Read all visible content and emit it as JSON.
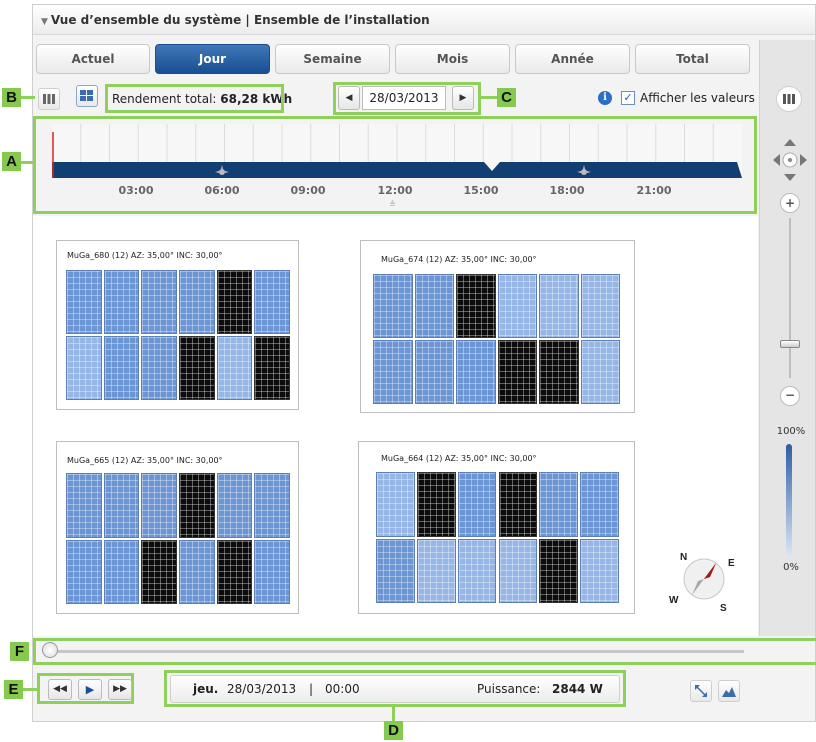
{
  "window": {
    "title": "Vue d’ensemble du système | Ensemble de l’installation"
  },
  "tabs": [
    {
      "label": "Actuel",
      "active": false
    },
    {
      "label": "Jour",
      "active": true
    },
    {
      "label": "Semaine",
      "active": false
    },
    {
      "label": "Mois",
      "active": false
    },
    {
      "label": "Année",
      "active": false
    },
    {
      "label": "Total",
      "active": false
    }
  ],
  "toolbar": {
    "yield_label": "Rendement total:",
    "yield_value": "68,28 kWh",
    "date": "28/03/2013",
    "show_values_label": "Afficher les valeurs",
    "show_values_checked": true
  },
  "timeline": {
    "ticks": [
      "03:00",
      "06:00",
      "09:00",
      "12:00",
      "15:00",
      "18:00",
      "21:00"
    ]
  },
  "panels": [
    {
      "title": "MuGa_680 (12) AZ: 35,00° INC: 30,00°",
      "cells": [
        1,
        1,
        1,
        1,
        0,
        1,
        2,
        1,
        1,
        0,
        2,
        0
      ]
    },
    {
      "title": "MuGa_674 (12) AZ: 35,00° INC: 30,00°",
      "cells": [
        1,
        1,
        0,
        2,
        2,
        2,
        1,
        1,
        1,
        0,
        0,
        2
      ]
    },
    {
      "title": "MuGa_665 (12) AZ: 35,00° INC: 30,00°",
      "cells": [
        1,
        1,
        1,
        0,
        1,
        1,
        1,
        1,
        0,
        1,
        0,
        1
      ]
    },
    {
      "title": "MuGa_664 (12) AZ: 35,00° INC: 30,00°",
      "cells": [
        2,
        0,
        1,
        0,
        1,
        1,
        1,
        2,
        2,
        2,
        0,
        2
      ]
    }
  ],
  "compass": {
    "n": "N",
    "e": "E",
    "s": "S",
    "w": "W"
  },
  "zoom": {
    "top_label": "100%",
    "bottom_label": "0%"
  },
  "status": {
    "day": "jeu.",
    "date": "28/03/2013",
    "separator": "|",
    "time": "00:00",
    "power_label": "Puissance:",
    "power_value": "2844 W"
  },
  "callouts": {
    "a": "A",
    "b": "B",
    "c": "C",
    "d": "D",
    "e": "E",
    "f": "F"
  },
  "colors": {
    "accent": "#174f92",
    "callout": "#86c94f",
    "module_dark": "#6c95d4",
    "module_light": "#96b6e6",
    "module_off": "#0c0c0c"
  }
}
